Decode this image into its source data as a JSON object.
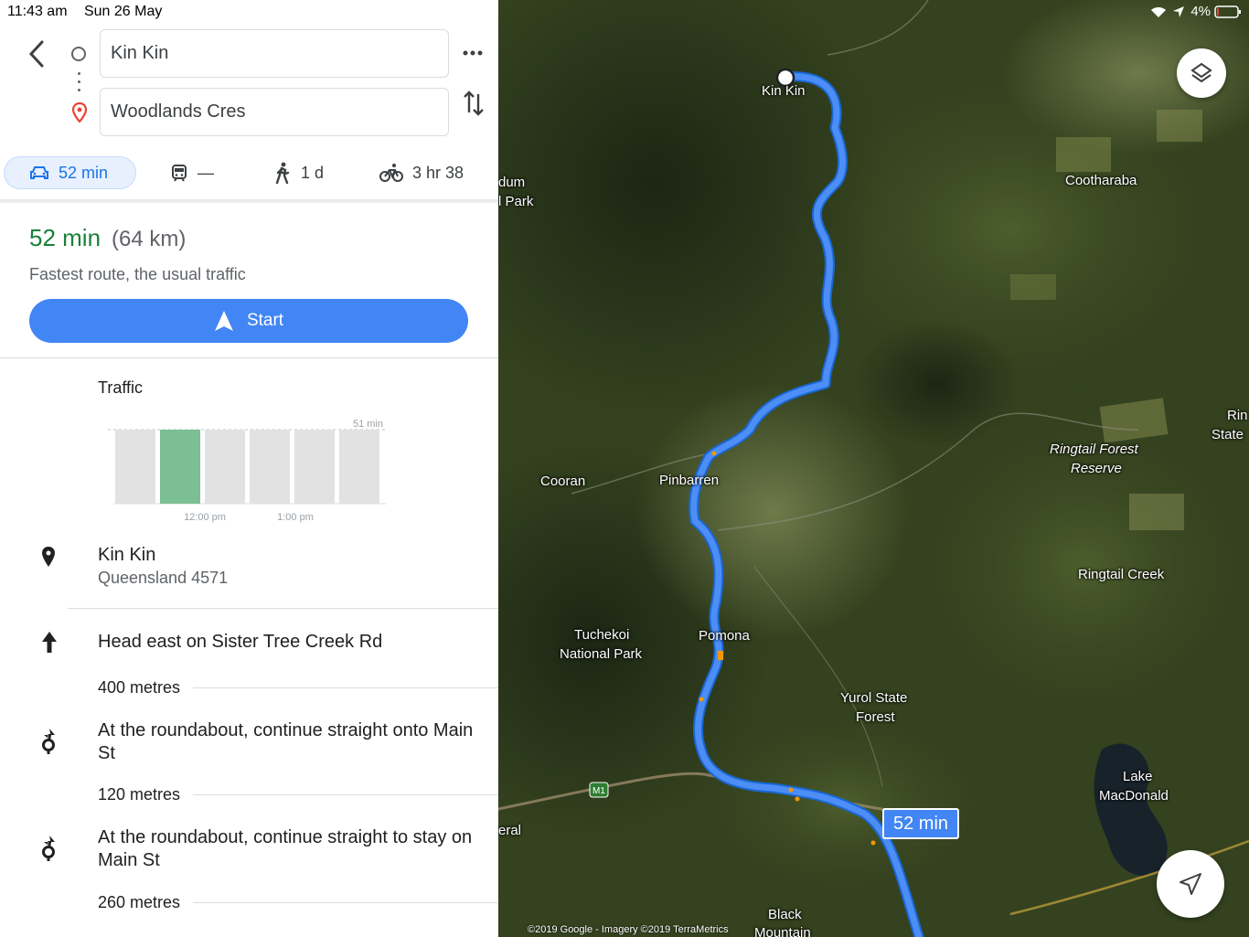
{
  "status_bar": {
    "time": "11:43 am",
    "date": "Sun 26 May",
    "battery": "4%"
  },
  "directions": {
    "origin": "Kin Kin",
    "destination": "Woodlands Cres",
    "modes": [
      {
        "name": "drive",
        "label": "52 min",
        "icon": "car-icon",
        "active": true
      },
      {
        "name": "transit",
        "label": "—",
        "icon": "train-icon"
      },
      {
        "name": "walk",
        "label": "1 d",
        "icon": "walking-icon"
      },
      {
        "name": "bike",
        "label": "3 hr 38",
        "icon": "bicycle-icon"
      }
    ]
  },
  "summary": {
    "time": "52 min",
    "distance": "(64 km)",
    "note": "Fastest route, the usual traffic",
    "start_label": "Start"
  },
  "traffic": {
    "title": "Traffic",
    "max_label": "51 min",
    "tick_labels": [
      "12:00 pm",
      "1:00 pm"
    ],
    "bars_fraction": [
      1,
      1,
      1,
      1,
      1,
      1
    ],
    "highlight_index": 1
  },
  "start_place": {
    "name": "Kin Kin",
    "sub": "Queensland 4571"
  },
  "steps": [
    {
      "icon": "arrow-up-icon",
      "text": "Head east on Sister Tree Creek Rd",
      "distance": "400 metres"
    },
    {
      "icon": "roundabout-icon",
      "text": "At the roundabout, continue straight onto Main St",
      "distance": "120 metres"
    },
    {
      "icon": "roundabout-icon",
      "text": "At the roundabout, continue straight to stay on Main St",
      "distance": "260 metres"
    }
  ],
  "map": {
    "labels": {
      "kin_kin": "Kin Kin",
      "cootharaba": "Cootharaba",
      "dum": "dum",
      "park": "l Park",
      "cooran": "Cooran",
      "pinbarren": "Pinbarren",
      "ringtail_forest": "Ringtail Forest",
      "reserve": "Reserve",
      "rin": "Rin",
      "state": "State",
      "ringtail_creek": "Ringtail Creek",
      "tuchekoi": "Tuchekoi",
      "national_park": "National Park",
      "pomona": "Pomona",
      "yurol": "Yurol State",
      "forest": "Forest",
      "lake": "Lake",
      "macdonald": "MacDonald",
      "eral": "eral",
      "black": "Black",
      "mountain": "Mountain",
      "m1": "M1"
    },
    "route_badge": "52 min",
    "copyright": "©2019 Google - Imagery ©2019 TerraMetrics",
    "route_color": "#4285f4"
  }
}
